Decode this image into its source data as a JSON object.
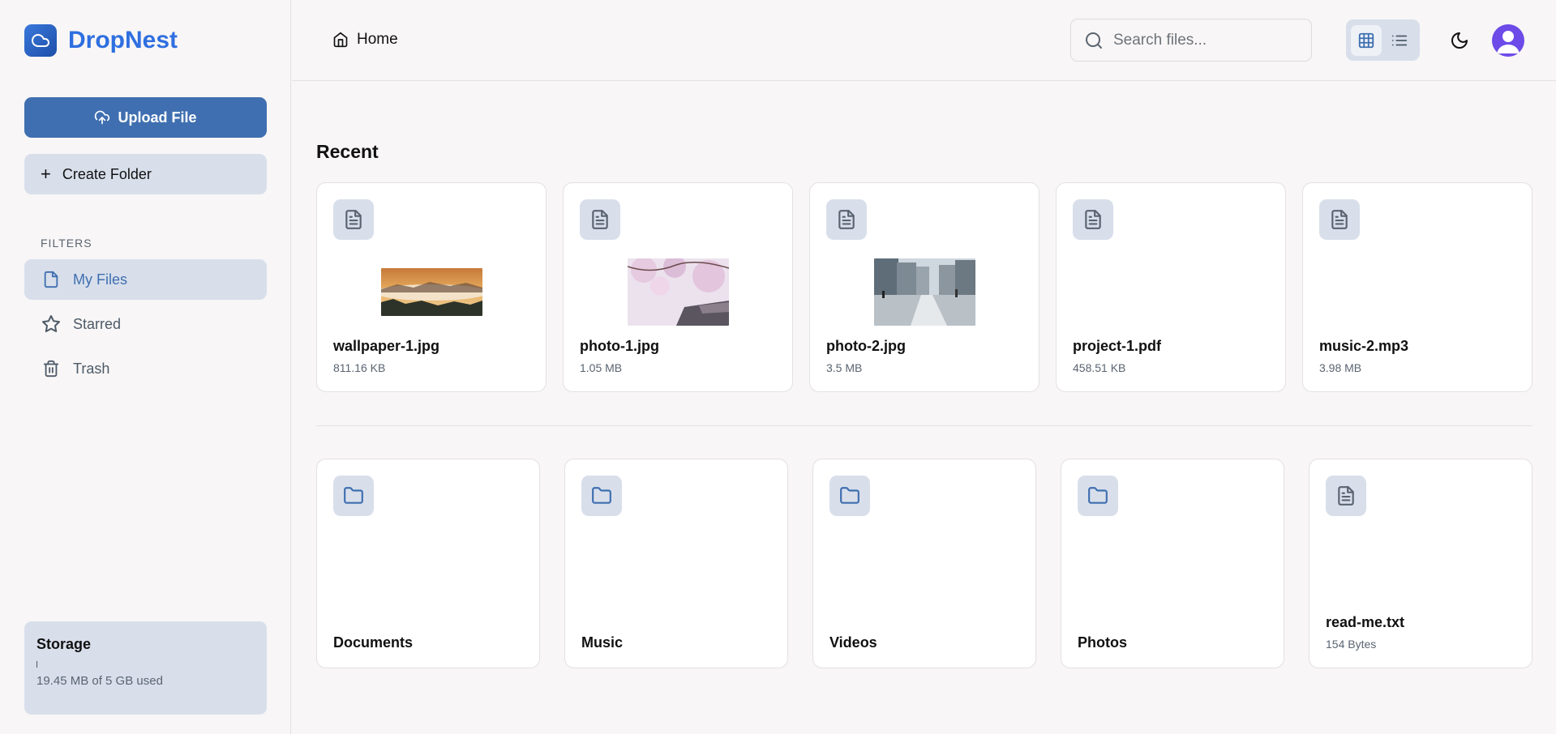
{
  "app": {
    "name": "DropNest"
  },
  "sidebar": {
    "upload_label": "Upload File",
    "create_folder_label": "Create Folder",
    "filters_label": "FILTERS",
    "items": [
      {
        "label": "My Files",
        "icon": "file-icon",
        "active": true
      },
      {
        "label": "Starred",
        "icon": "star-icon",
        "active": false
      },
      {
        "label": "Trash",
        "icon": "trash-icon",
        "active": false
      }
    ],
    "storage": {
      "title": "Storage",
      "used_text": "19.45 MB of 5 GB used",
      "used_fraction": 0.0038
    }
  },
  "topbar": {
    "breadcrumb": "Home",
    "search_placeholder": "Search files...",
    "view_mode": "grid"
  },
  "recent": {
    "title": "Recent",
    "files": [
      {
        "name": "wallpaper-1.jpg",
        "size": "811.16 KB",
        "thumb": "sunset-mountains"
      },
      {
        "name": "photo-1.jpg",
        "size": "1.05 MB",
        "thumb": "cherry-blossom"
      },
      {
        "name": "photo-2.jpg",
        "size": "3.5 MB",
        "thumb": "city-street"
      },
      {
        "name": "project-1.pdf",
        "size": "458.51 KB"
      },
      {
        "name": "music-2.mp3",
        "size": "3.98 MB"
      }
    ]
  },
  "items": [
    {
      "name": "Documents",
      "kind": "folder"
    },
    {
      "name": "Music",
      "kind": "folder"
    },
    {
      "name": "Videos",
      "kind": "folder"
    },
    {
      "name": "Photos",
      "kind": "folder"
    },
    {
      "name": "read-me.txt",
      "kind": "file",
      "size": "154 Bytes"
    }
  ],
  "colors": {
    "accent": "#3f6fb0",
    "brand": "#2f6fe0",
    "chip": "#d8dfeb"
  }
}
